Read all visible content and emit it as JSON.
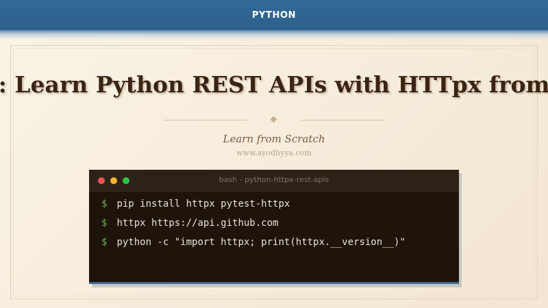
{
  "header": {
    "category": "PYTHON"
  },
  "article": {
    "title": ": Learn Python REST APIs with HTTpx from",
    "subtitle": "Learn from Scratch",
    "site": "www.ayodhyya.com"
  },
  "terminal": {
    "window_title": "bash - python-httpx-rest-apis",
    "lines": [
      {
        "prompt": "$",
        "command": "pip install httpx pytest-httpx"
      },
      {
        "prompt": "$",
        "command": "httpx https://api.github.com"
      },
      {
        "prompt": "$",
        "command": "python -c \"import httpx; print(httpx.__version__)\""
      }
    ]
  },
  "colors": {
    "header_bg": "#2c5f8c",
    "page_bg": "#f6ecdb",
    "title_text": "#3b2412",
    "terminal_bg": "#1e140c",
    "prompt_green": "#6ab04c",
    "dot_red": "#f0524d",
    "dot_yellow": "#f4b42b",
    "dot_green": "#30c346"
  }
}
